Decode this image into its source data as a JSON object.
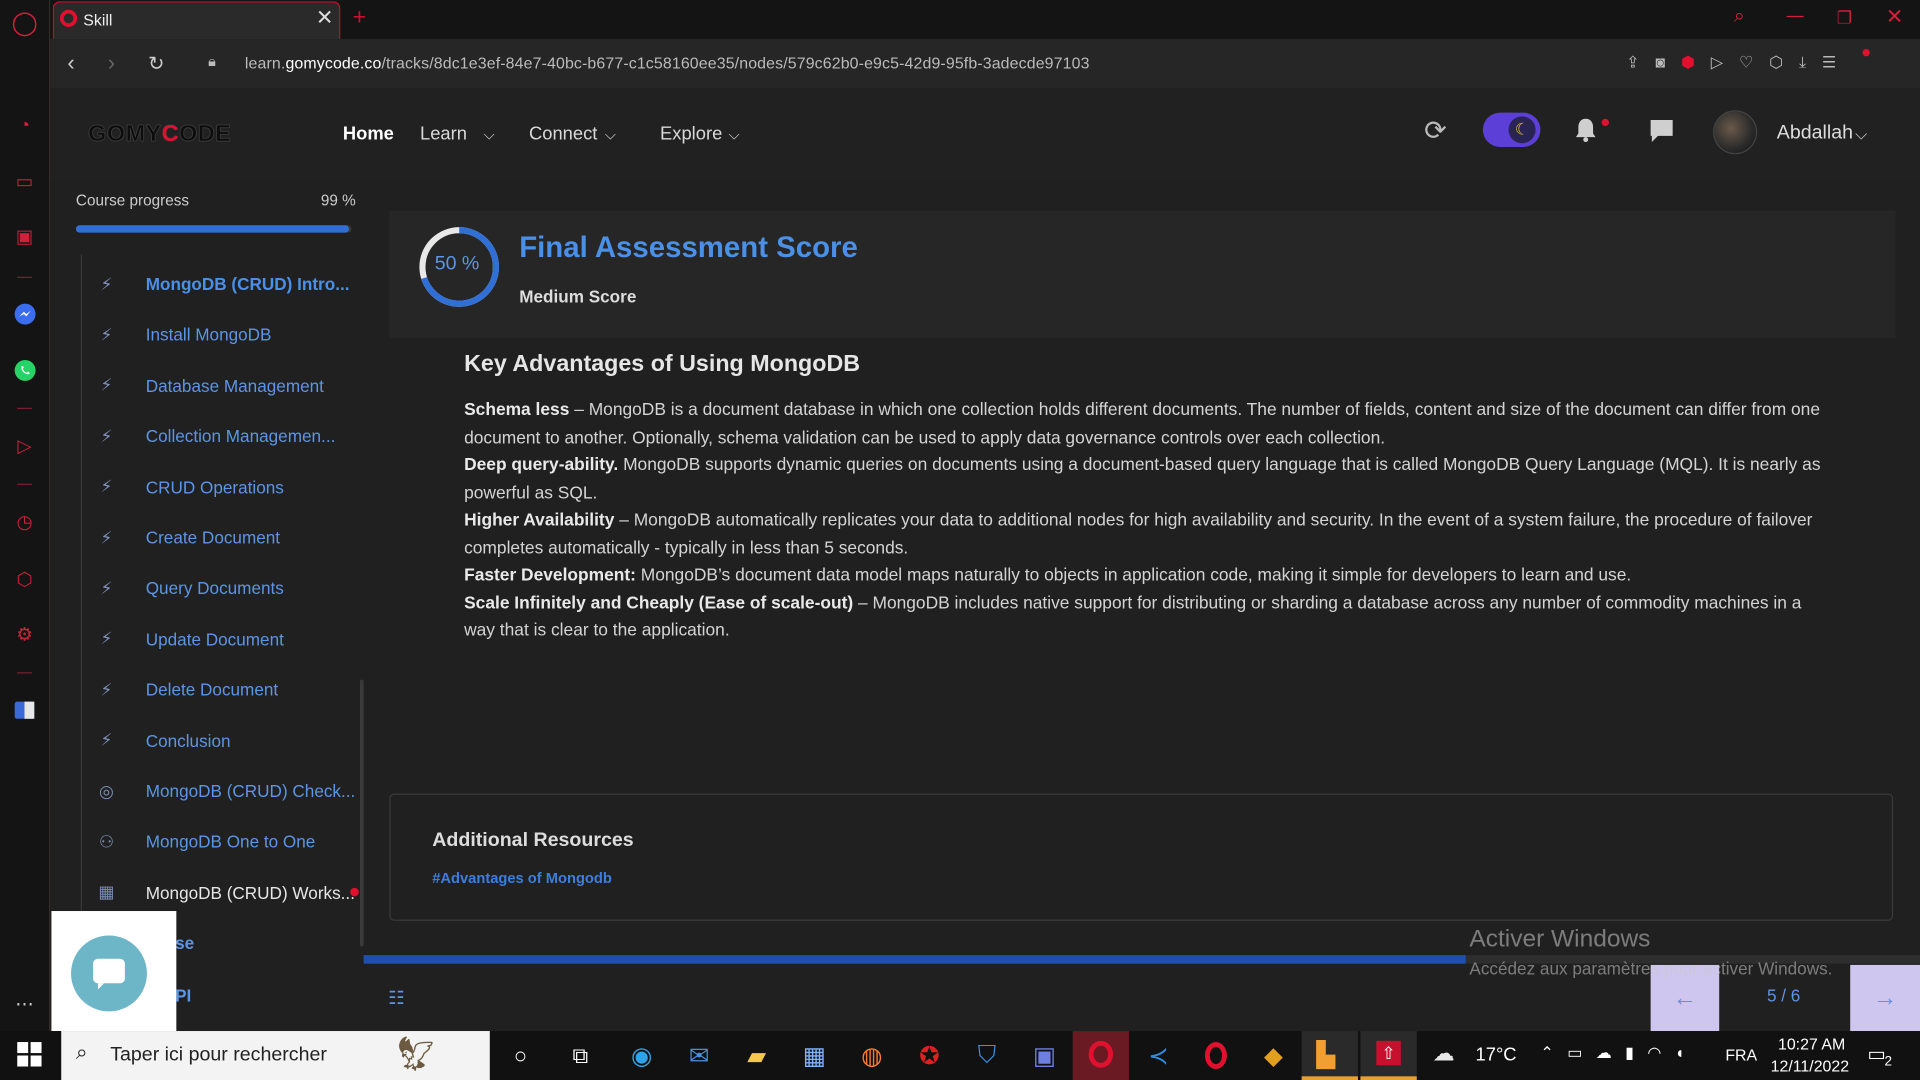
{
  "browser": {
    "tab_title": "Skill",
    "url_prefix": "learn.",
    "url_domain": "gomycode.co",
    "url_rest": "/tracks/8dc1e3ef-84e7-40bc-b677-c1c58160ee35/nodes/579c62b0-e9c5-42d9-95fb-3adecde97103"
  },
  "app": {
    "logo": "GOMYCODE",
    "nav": {
      "home": "Home",
      "learn": "Learn",
      "connect": "Connect",
      "explore": "Explore"
    },
    "user_name": "Abdallah"
  },
  "course": {
    "progress_label": "Course progress",
    "progress_value": "99 %",
    "progress_fraction": 0.99,
    "lessons": [
      {
        "label": "MongoDB (CRUD) Intro...",
        "icon": "bolt-icon"
      },
      {
        "label": "Install MongoDB",
        "icon": "bolt-icon"
      },
      {
        "label": "Database Management",
        "icon": "bolt-icon"
      },
      {
        "label": "Collection Managemen...",
        "icon": "bolt-icon"
      },
      {
        "label": "CRUD Operations",
        "icon": "bolt-icon"
      },
      {
        "label": "Create Document",
        "icon": "bolt-icon"
      },
      {
        "label": "Query Documents",
        "icon": "bolt-icon"
      },
      {
        "label": "Update Document",
        "icon": "bolt-icon"
      },
      {
        "label": "Delete Document",
        "icon": "bolt-icon"
      },
      {
        "label": "Conclusion",
        "icon": "bolt-icon"
      },
      {
        "label": "MongoDB (CRUD) Check...",
        "icon": "target-icon"
      },
      {
        "label": "MongoDB One to One",
        "icon": "people-icon"
      },
      {
        "label": "MongoDB (CRUD) Works...",
        "icon": "workshop-icon"
      }
    ],
    "partial_item_1": "se",
    "partial_item_2": "PI"
  },
  "score": {
    "percent_label": "50 %",
    "percent": 0.5,
    "title": "Final Assessment Score",
    "subtitle": "Medium Score"
  },
  "content": {
    "heading": "Key Advantages of Using MongoDB",
    "paragraphs": [
      {
        "bold": "Schema less",
        "text": " – MongoDB is a document database in which one collection holds different documents. The number of fields, content and size of the document can differ from one document to another. Optionally, schema validation can be used to apply data governance controls over each collection."
      },
      {
        "bold": "Deep query-ability.",
        "text": " MongoDB supports dynamic queries on documents using a document-based query language that is called MongoDB Query Language (MQL). It is nearly as powerful as SQL."
      },
      {
        "bold": "Higher Availability",
        "text": " – MongoDB automatically replicates your data to additional nodes for high availability and security. In the event of a system failure, the procedure of failover completes automatically - typically in less than 5 seconds."
      },
      {
        "bold": "Faster Development:",
        "text": " MongoDB’s document data model maps naturally to objects in application code, making it simple for developers to learn and use."
      },
      {
        "bold": "Scale Infinitely and Cheaply (Ease of scale-out)",
        "text": " – MongoDB includes native support for distributing or sharding a database across any number of commodity machines in a way that is clear to the application."
      }
    ]
  },
  "resources": {
    "title": "Additional Resources",
    "link": "#Advantages of Mongodb"
  },
  "pager": {
    "label": "5 / 6",
    "fraction": 0.8333
  },
  "watermark": {
    "title": "Activer Windows",
    "subtitle": "Accédez aux paramètres pour activer Windows."
  },
  "taskbar": {
    "search_placeholder": "Taper ici pour rechercher",
    "temperature": "17°C",
    "language": "FRA",
    "time": "10:27 AM",
    "date": "12/11/2022",
    "notif_count": "2"
  },
  "colors": {
    "accent": "#2f6fd6",
    "link": "#5b95e6",
    "opera_red": "#d0203a",
    "toggle": "#5b3fd6"
  }
}
